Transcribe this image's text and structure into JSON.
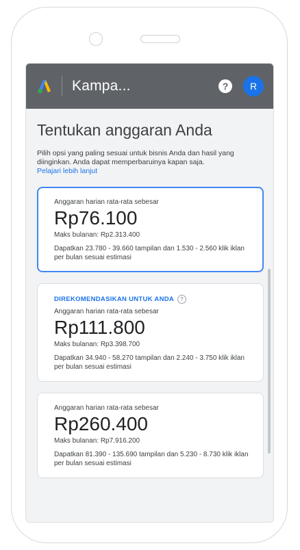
{
  "app_bar": {
    "title": "Kampa...",
    "help_icon": "help-circle-icon",
    "help_glyph": "?",
    "avatar_initial": "R",
    "colors": {
      "bar": "#5f6368",
      "avatar": "#1a73e8"
    }
  },
  "page": {
    "title": "Tentukan anggaran Anda",
    "intro": "Pilih opsi yang paling sesuai untuk bisnis Anda dan hasil yang diinginkan. Anda dapat memperbaruinya kapan saja.",
    "learn_more": "Pelajari lebih lanjut"
  },
  "options": [
    {
      "label": "Anggaran harian rata-rata sebesar",
      "amount": "Rp76.100",
      "max": "Maks bulanan: Rp2.313.400",
      "estimate": "Dapatkan 23.780 - 39.660 tampilan dan 1.530 - 2.560 klik iklan per bulan sesuai estimasi",
      "selected": true
    },
    {
      "recommended": "DIREKOMENDASIKAN UNTUK ANDA",
      "label": "Anggaran harian rata-rata sebesar",
      "amount": "Rp111.800",
      "max": "Maks bulanan: Rp3.398.700",
      "estimate": "Dapatkan 34.940 - 58.270 tampilan dan 2.240 - 3.750 klik iklan per bulan sesuai estimasi",
      "selected": false
    },
    {
      "label": "Anggaran harian rata-rata sebesar",
      "amount": "Rp260.400",
      "max": "Maks bulanan: Rp7.916.200",
      "estimate": "Dapatkan 81.390 - 135.690 tampilan dan 5.230 - 8.730 klik iklan per bulan sesuai estimasi",
      "selected": false
    }
  ],
  "colors": {
    "accent": "#1a73e8",
    "selected_border": "#4285f4",
    "screen_bg": "#f1f3f4"
  }
}
